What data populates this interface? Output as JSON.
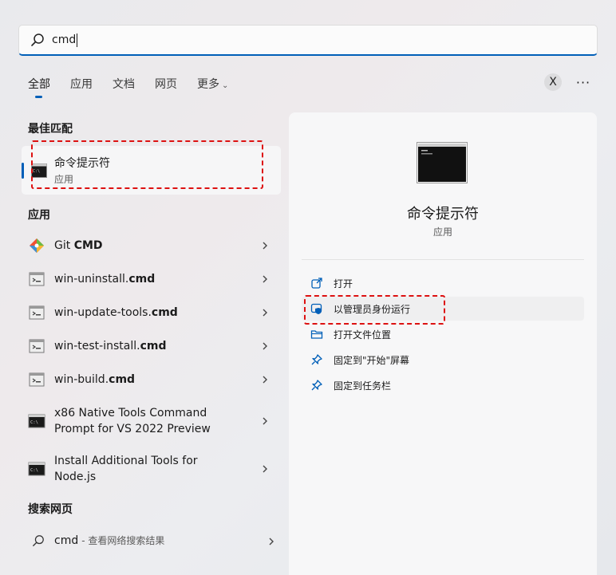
{
  "search": {
    "query": "cmd"
  },
  "tabs": [
    {
      "label": "全部"
    },
    {
      "label": "应用"
    },
    {
      "label": "文档"
    },
    {
      "label": "网页"
    },
    {
      "label": "更多"
    }
  ],
  "top_buttons": {
    "close_label": "X",
    "more_label": "···"
  },
  "sections": {
    "best_match": "最佳匹配",
    "apps": "应用",
    "web": "搜索网页"
  },
  "best_match": {
    "title": "命令提示符",
    "subtitle": "应用"
  },
  "apps": [
    {
      "prefix": "Git ",
      "bold": "CMD",
      "line2": ""
    },
    {
      "prefix": "win-uninstall.",
      "bold": "cmd",
      "line2": ""
    },
    {
      "prefix": "win-update-tools.",
      "bold": "cmd",
      "line2": ""
    },
    {
      "prefix": "win-test-install.",
      "bold": "cmd",
      "line2": ""
    },
    {
      "prefix": "win-build.",
      "bold": "cmd",
      "line2": ""
    },
    {
      "prefix": "x86 Native Tools Command",
      "bold": "",
      "line2": "Prompt for VS 2022 Preview"
    },
    {
      "prefix": "Install Additional Tools for",
      "bold": "",
      "line2": "Node.js"
    }
  ],
  "web_search": {
    "query": "cmd",
    "suffix": "- 查看网络搜索结果"
  },
  "detail": {
    "title": "命令提示符",
    "subtitle": "应用",
    "actions": [
      {
        "label": "打开",
        "icon": "open-external-icon"
      },
      {
        "label": "以管理员身份运行",
        "icon": "shield-admin-icon"
      },
      {
        "label": "打开文件位置",
        "icon": "folder-icon"
      },
      {
        "label": "固定到\"开始\"屏幕",
        "icon": "pin-icon"
      },
      {
        "label": "固定到任务栏",
        "icon": "pin-icon"
      }
    ]
  },
  "colors": {
    "accent": "#005fb8",
    "highlight_dash": "#dd1111"
  }
}
